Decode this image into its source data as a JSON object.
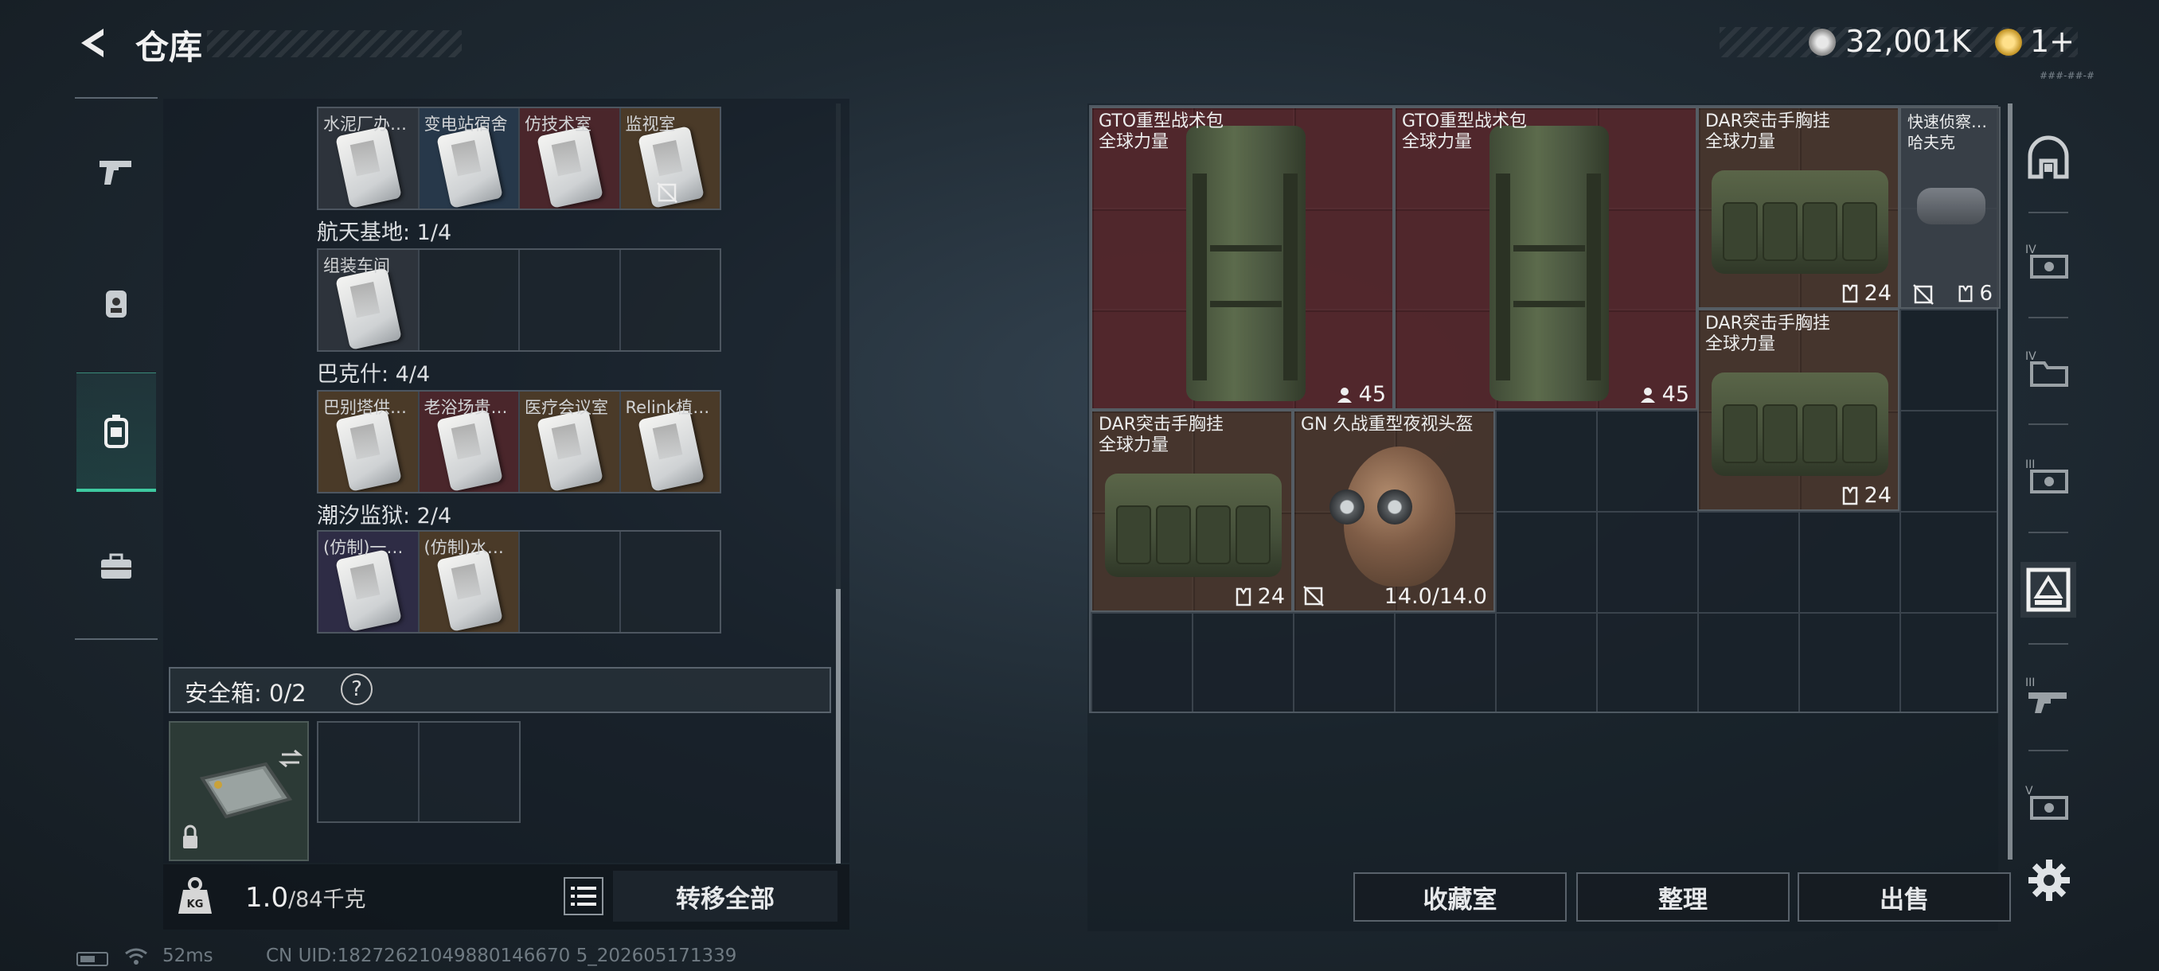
{
  "header": {
    "title": "仓库"
  },
  "currency": {
    "silver": "32,001K",
    "gold": "1+",
    "tiny_text": "###-##-#"
  },
  "left_categories": [
    {
      "name": "weapons",
      "icon": "gun-icon"
    },
    {
      "name": "gear",
      "icon": "backpack-person-icon"
    },
    {
      "name": "containers",
      "icon": "backpack-icon",
      "selected": true
    },
    {
      "name": "tools",
      "icon": "toolbox-icon"
    }
  ],
  "keycard_groups": [
    {
      "label": "",
      "cells": [
        {
          "name": "水泥厂办…",
          "bg": "gray"
        },
        {
          "name": "变电站宿舍",
          "bg": "blue"
        },
        {
          "name": "仿技术室",
          "bg": "red"
        },
        {
          "name": "监视室",
          "bg": "gold",
          "no_sell": true
        }
      ]
    },
    {
      "label": "航天基地: 1/4",
      "cells": [
        {
          "name": "组装车间",
          "bg": "gray"
        },
        {
          "name": "",
          "bg": ""
        },
        {
          "name": "",
          "bg": ""
        },
        {
          "name": "",
          "bg": ""
        }
      ]
    },
    {
      "label": "巴克什: 4/4",
      "cells": [
        {
          "name": "巴别塔供…",
          "bg": "gold"
        },
        {
          "name": "老浴场贵…",
          "bg": "red"
        },
        {
          "name": "医疗会议室",
          "bg": "gold"
        },
        {
          "name": "Relink植…",
          "bg": "gold"
        }
      ]
    },
    {
      "label": "潮汐监狱: 2/4",
      "cells": [
        {
          "name": "(仿制)一…",
          "bg": "purple"
        },
        {
          "name": "(仿制)水…",
          "bg": "gold"
        },
        {
          "name": "",
          "bg": ""
        },
        {
          "name": "",
          "bg": ""
        }
      ]
    }
  ],
  "safe_box": {
    "label": "安全箱:  0/2",
    "help": "?"
  },
  "bottom_left": {
    "weight_value": "1.0",
    "weight_max": "/84千克",
    "transfer_all": "转移全部"
  },
  "status": {
    "ping": "52ms",
    "uid": "CN UID:18272621049880146670 5_202605171339"
  },
  "storage_items": [
    {
      "id": "gto1",
      "name": "GTO重型战术包",
      "sub": "全球力量",
      "badge": "45",
      "badge_icon": "capacity-icon"
    },
    {
      "id": "gto2",
      "name": "GTO重型战术包",
      "sub": "全球力量",
      "badge": "45",
      "badge_icon": "capacity-icon"
    },
    {
      "id": "dar1",
      "name": "DAR突击手胸挂",
      "sub": "全球力量",
      "badge": "24",
      "badge_icon": "vest-icon"
    },
    {
      "id": "recon",
      "name": "快速侦察…",
      "sub": "哈夫克",
      "badge": "6",
      "badge_icon": "vest-icon",
      "no_sell": true
    },
    {
      "id": "dar2",
      "name": "DAR突击手胸挂",
      "sub": "全球力量",
      "badge": "24",
      "badge_icon": "vest-icon"
    },
    {
      "id": "dar3",
      "name": "DAR突击手胸挂",
      "sub": "全球力量",
      "badge": "24",
      "badge_icon": "vest-icon"
    },
    {
      "id": "helmet",
      "name": "GN 久战重型夜视头盔",
      "sub": "",
      "badge": "14.0/14.0",
      "badge_icon": "",
      "no_sell": true
    }
  ],
  "actions": {
    "collection": "收藏室",
    "sort": "整理",
    "sell": "出售"
  },
  "right_sidebar": [
    {
      "name": "container-arch-icon"
    },
    {
      "name": "ammo-crate-iv-icon",
      "tier": "IV"
    },
    {
      "name": "folder-iv-icon",
      "tier": "IV"
    },
    {
      "name": "ammo-crate-iii-icon",
      "tier": "III"
    },
    {
      "name": "armor-crate-icon",
      "selected": true
    },
    {
      "name": "weapon-iii-icon",
      "tier": "III"
    },
    {
      "name": "weapon-v-icon",
      "tier": "V"
    }
  ]
}
